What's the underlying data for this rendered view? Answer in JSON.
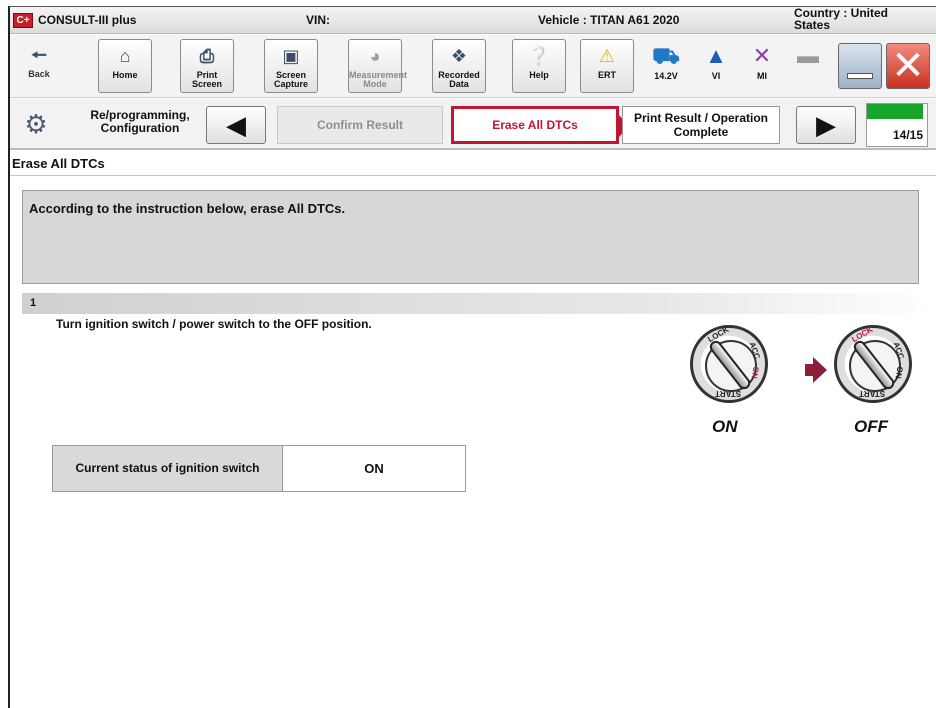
{
  "titlebar": {
    "logo_text": "C+",
    "app_name": "CONSULT-III plus",
    "vin": "VIN:",
    "vehicle": "Vehicle : TITAN A61 2020",
    "country": "Country : United States"
  },
  "toolbar": {
    "back": "Back",
    "home": "Home",
    "print_screen": "Print Screen",
    "screen_capture": "Screen Capture",
    "measurement_mode": "Measurement Mode",
    "recorded_data": "Recorded Data",
    "help": "Help",
    "ert": "ERT",
    "battery_voltage": "14.2V",
    "vi": "VI",
    "mi": "MI"
  },
  "steps": {
    "section": "Re/programming, Configuration",
    "previous": "Confirm Result",
    "current": "Erase All DTCs",
    "next": "Print Result / Operation Complete",
    "counter": "14/15",
    "progress_fraction": 0.93
  },
  "page": {
    "title": "Erase All DTCs",
    "instruction": "According to the instruction below, erase All DTCs.",
    "step_number": "1",
    "step_text": "Turn ignition switch / power switch to the OFF position."
  },
  "ignition": {
    "from_label": "ON",
    "to_label": "OFF",
    "dial_lock": "LOCK",
    "dial_acc": "ACC",
    "dial_on": "ON",
    "dial_start": "START"
  },
  "status": {
    "label": "Current status of ignition switch",
    "value": "ON"
  },
  "colors": {
    "accent_red": "#c41436",
    "progress_green": "#17a52b"
  }
}
